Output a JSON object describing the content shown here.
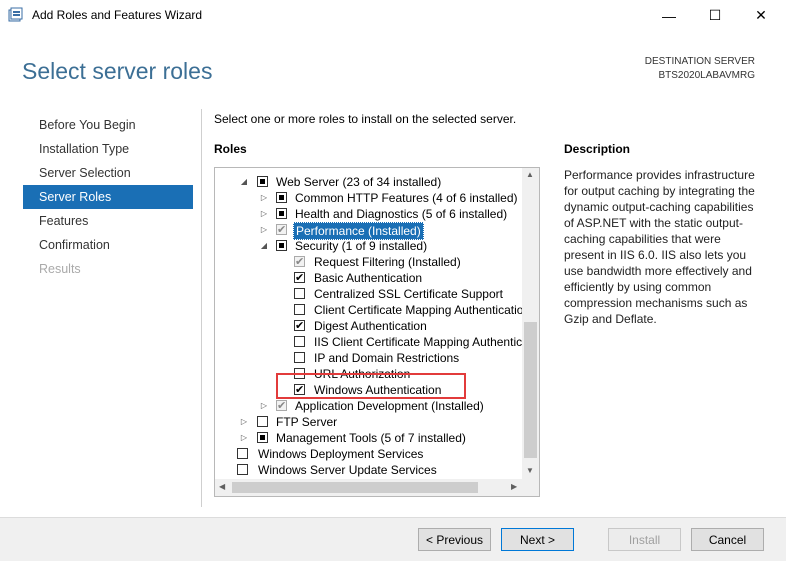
{
  "window": {
    "title": "Add Roles and Features Wizard",
    "min_glyph": "—",
    "max_glyph": "☐",
    "close_glyph": "✕"
  },
  "header": {
    "page_title": "Select server roles",
    "dest_label": "DESTINATION SERVER",
    "dest_name": "BTS2020LABAVMRG"
  },
  "nav": {
    "items": [
      {
        "label": "Before You Begin"
      },
      {
        "label": "Installation Type"
      },
      {
        "label": "Server Selection"
      },
      {
        "label": "Server Roles"
      },
      {
        "label": "Features"
      },
      {
        "label": "Confirmation"
      },
      {
        "label": "Results"
      }
    ]
  },
  "main": {
    "instruction": "Select one or more roles to install on the selected server.",
    "roles_label": "Roles",
    "description_label": "Description",
    "description_text": "Performance provides infrastructure for output caching by integrating the dynamic output-caching capabilities of ASP.NET with the static output-caching capabilities that were present in IIS 6.0. IIS also lets you use bandwidth more effectively and efficiently by using common compression mechanisms such as Gzip and Deflate."
  },
  "tree": {
    "rows": [
      {
        "label": "Web Server (23 of 34 installed)"
      },
      {
        "label": "Common HTTP Features (4 of 6 installed)"
      },
      {
        "label": "Health and Diagnostics (5 of 6 installed)"
      },
      {
        "label": "Performance (Installed)"
      },
      {
        "label": "Security (1 of 9 installed)"
      },
      {
        "label": "Request Filtering (Installed)"
      },
      {
        "label": "Basic Authentication"
      },
      {
        "label": "Centralized SSL Certificate Support"
      },
      {
        "label": "Client Certificate Mapping Authentication"
      },
      {
        "label": "Digest Authentication"
      },
      {
        "label": "IIS Client Certificate Mapping Authentication"
      },
      {
        "label": "IP and Domain Restrictions"
      },
      {
        "label": "URL Authorization"
      },
      {
        "label": "Windows Authentication"
      },
      {
        "label": "Application Development (Installed)"
      },
      {
        "label": "FTP Server"
      },
      {
        "label": "Management Tools (5 of 7 installed)"
      },
      {
        "label": "Windows Deployment Services"
      },
      {
        "label": "Windows Server Update Services"
      }
    ]
  },
  "footer": {
    "previous": "< Previous",
    "next": "Next >",
    "install": "Install",
    "cancel": "Cancel"
  },
  "colors": {
    "accent": "#1a6fb5",
    "title_blue": "#3c6f95",
    "highlight_red": "#e23b3b"
  }
}
